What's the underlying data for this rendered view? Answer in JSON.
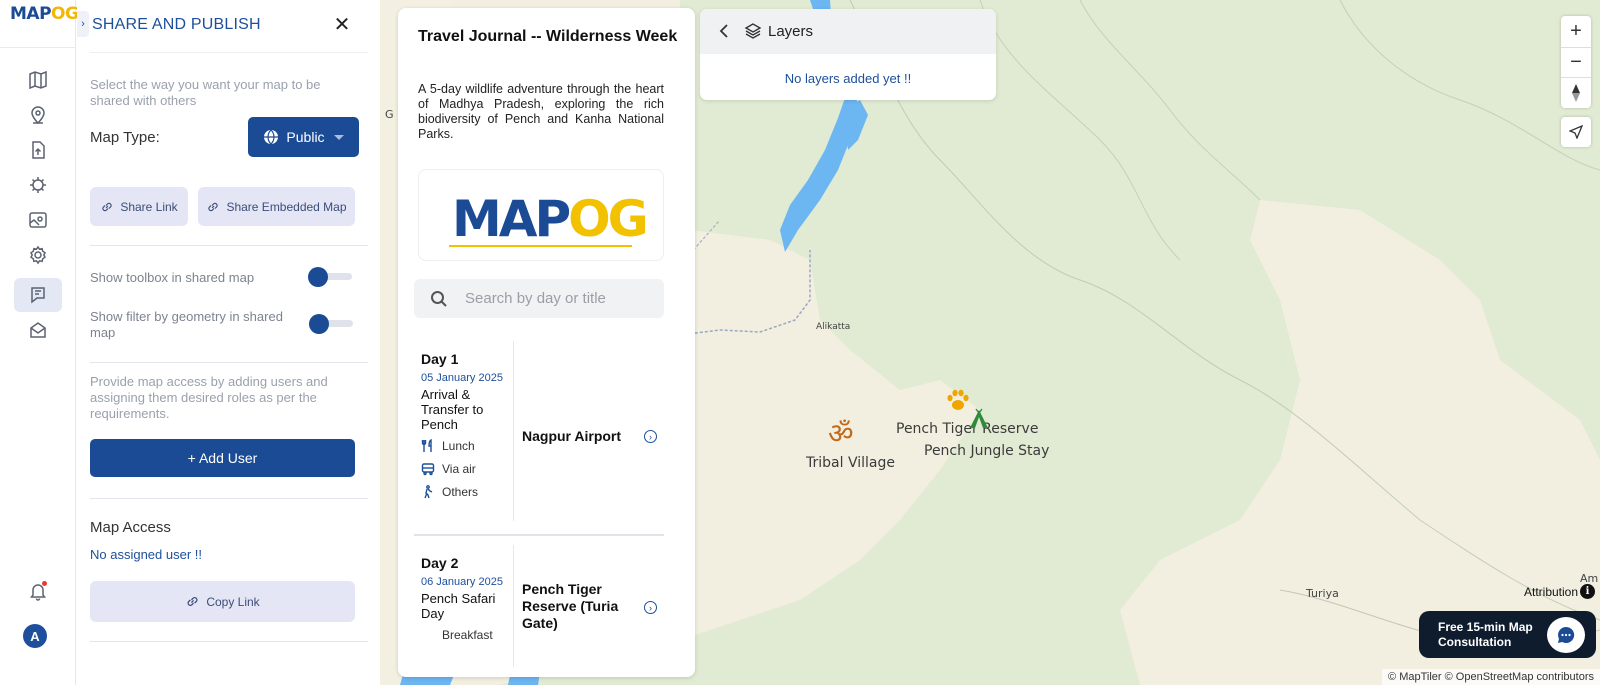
{
  "app": {
    "logo_main": "MAP",
    "logo_accent": "OG"
  },
  "share_panel": {
    "title": "SHARE AND PUBLISH",
    "intro": "Select the way you want your map to be shared with others",
    "map_type_label": "Map Type:",
    "map_type_value": "Public",
    "share_link_label": "Share Link",
    "share_embedded_label": "Share Embedded Map",
    "toggle_toolbox_label": "Show toolbox in shared map",
    "toggle_filter_label": "Show filter by geometry in shared map",
    "access_help": "Provide map access by adding users and assigning them desired roles as per the requirements.",
    "add_user_label": "+ Add User",
    "map_access_title": "Map Access",
    "no_user_text": "No assigned user !!",
    "copy_link_label": "Copy Link"
  },
  "journal": {
    "title": "Travel Journal -- Wilderness Week",
    "description": "A 5-day wildlife adventure through the heart of Madhya Pradesh, exploring the rich biodiversity of Pench and Kanha National Parks.",
    "logo_main": "MAP",
    "logo_accent": "OG",
    "search_placeholder": "Search by day or title",
    "days": [
      {
        "day": "Day 1",
        "date": "05 January 2025",
        "name": "Arrival & Transfer to Pench",
        "meals": "Lunch",
        "transport": "Via air",
        "activity": "Others",
        "place": "Nagpur Airport"
      },
      {
        "day": "Day 2",
        "date": "06 January 2025",
        "name": "Pench Safari Day",
        "meals": "Breakfast",
        "place": "Pench Tiger Reserve (Turia Gate)"
      }
    ]
  },
  "layers": {
    "title": "Layers",
    "empty_text": "No layers added yet !!"
  },
  "map": {
    "labels": {
      "alikatta": "Alikatta",
      "turiya": "Turiya",
      "am": "Am",
      "g": "G",
      "tribal_village": "Tribal Village",
      "pench_reserve": "Pench Tiger Reserve",
      "pench_stay": "Pench Jungle Stay"
    },
    "attribution_label": "Attribution",
    "copyright": "© MapTiler © OpenStreetMap contributors",
    "consult_text": "Free 15-min Map Consultation",
    "colors": {
      "water": "#6cb6f2",
      "forest": "#e1ead2",
      "open_land": "#f2efe0",
      "primary": "#1b4b95",
      "accent": "#f2b705"
    }
  }
}
